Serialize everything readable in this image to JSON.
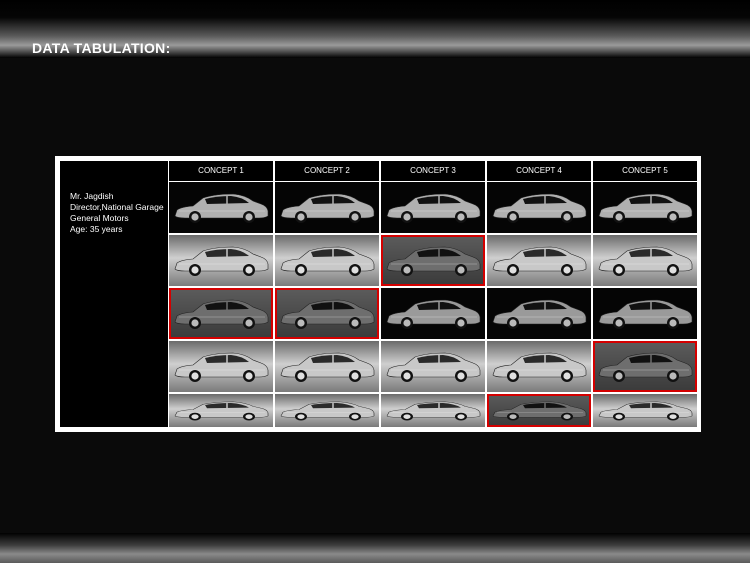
{
  "slide": {
    "title": "DATA TABULATION:"
  },
  "respondent": {
    "name": "Mr. Jagdish",
    "title": "Director,National Garage",
    "company": "General Motors",
    "age": "Age: 35 years"
  },
  "concepts": [
    "CONCEPT 1",
    "CONCEPT 2",
    "CONCEPT 3",
    "CONCEPT 4",
    "CONCEPT 5"
  ],
  "rows": [
    {
      "style": "dark",
      "selected": [
        false,
        false,
        false,
        false,
        false
      ]
    },
    {
      "style": "light",
      "selected": [
        false,
        false,
        true,
        false,
        false
      ]
    },
    {
      "style": "gray",
      "selected": [
        true,
        true,
        false,
        false,
        false
      ]
    },
    {
      "style": "light",
      "selected": [
        false,
        false,
        false,
        false,
        true
      ]
    },
    {
      "style": "light",
      "selected": [
        false,
        false,
        false,
        true,
        false
      ]
    }
  ],
  "colors": {
    "selection": "#d40000",
    "background": "#0a0a0a"
  }
}
